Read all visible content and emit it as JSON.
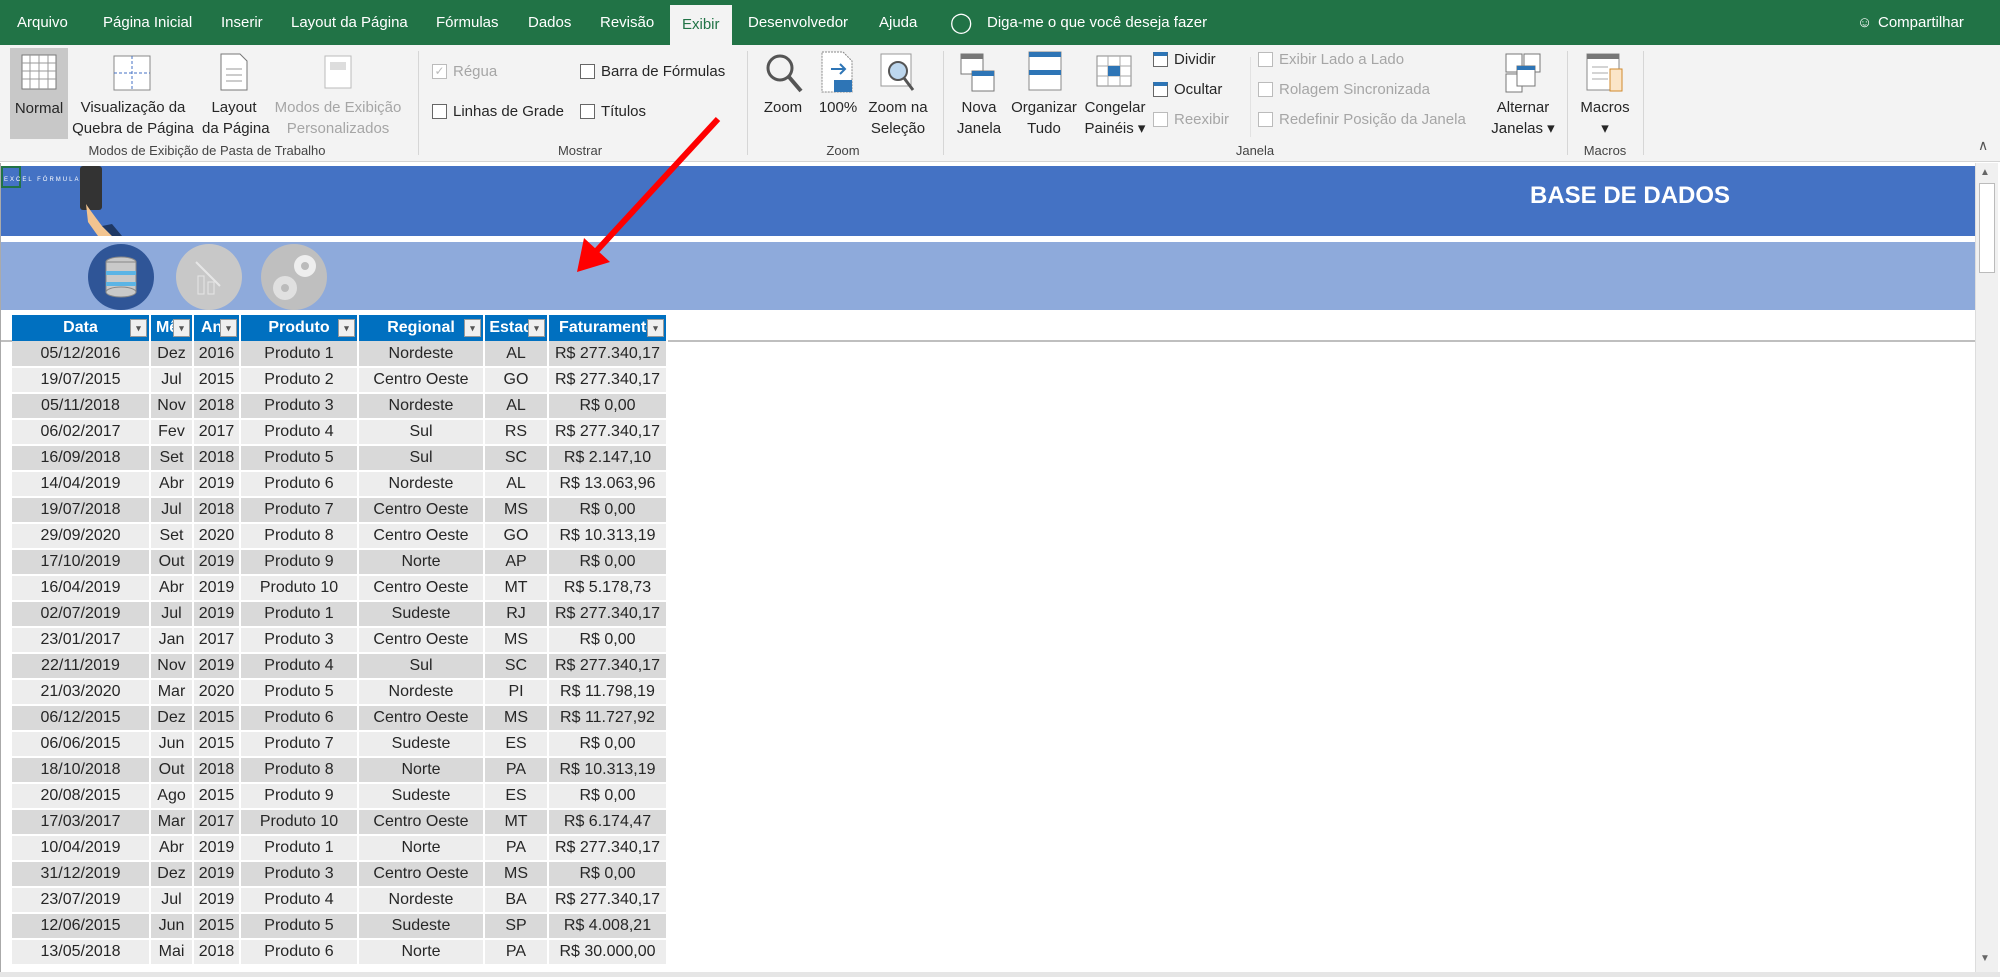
{
  "tabs": [
    "Arquivo",
    "Página Inicial",
    "Inserir",
    "Layout da Página",
    "Fórmulas",
    "Dados",
    "Revisão",
    "Exibir",
    "Desenvolvedor",
    "Ajuda"
  ],
  "active_tab": "Exibir",
  "tell_me": "Diga-me o que você deseja fazer",
  "share": "Compartilhar",
  "ribbon": {
    "views": {
      "normal": "Normal",
      "page_break_1": "Visualização da",
      "page_break_2": "Quebra de Página",
      "page_layout_1": "Layout",
      "page_layout_2": "da Página",
      "custom_1": "Modos de Exibição",
      "custom_2": "Personalizados",
      "group": "Modos de Exibição de Pasta de Trabalho"
    },
    "show": {
      "ruler": "Régua",
      "formula_bar": "Barra de Fórmulas",
      "gridlines": "Linhas de Grade",
      "headings": "Títulos",
      "group": "Mostrar",
      "ruler_checked": true,
      "formula_bar_checked": false,
      "gridlines_checked": false,
      "headings_checked": false
    },
    "zoom": {
      "zoom": "Zoom",
      "hundred": "100%",
      "sel_1": "Zoom na",
      "sel_2": "Seleção",
      "group": "Zoom"
    },
    "window": {
      "new_1": "Nova",
      "new_2": "Janela",
      "arrange_1": "Organizar",
      "arrange_2": "Tudo",
      "freeze_1": "Congelar",
      "freeze_2": "Painéis",
      "split": "Dividir",
      "hide": "Ocultar",
      "unhide": "Reexibir",
      "side": "Exibir Lado a Lado",
      "sync": "Rolagem Sincronizada",
      "reset": "Redefinir Posição da Janela",
      "switch_1": "Alternar",
      "switch_2": "Janelas",
      "group": "Janela"
    },
    "macros": {
      "label": "Macros",
      "group": "Macros"
    }
  },
  "sheet": {
    "title": "BASE DE DADOS",
    "logo_text": "EXCEL FÓRMULA",
    "nav_icons": [
      "database-icon",
      "chart-icon",
      "gears-icon"
    ],
    "colors": {
      "banner": "#4472c4",
      "band": "#8eaadb",
      "header": "#0070c0",
      "tab_green": "#217346",
      "arrow": "#ff0000"
    },
    "columns": [
      "Data",
      "Mês",
      "Ano",
      "Produto",
      "Regional",
      "Estado",
      "Faturamento"
    ],
    "rows": [
      [
        "05/12/2016",
        "Dez",
        "2016",
        "Produto 1",
        "Nordeste",
        "AL",
        "R$ 277.340,17"
      ],
      [
        "19/07/2015",
        "Jul",
        "2015",
        "Produto 2",
        "Centro Oeste",
        "GO",
        "R$ 277.340,17"
      ],
      [
        "05/11/2018",
        "Nov",
        "2018",
        "Produto 3",
        "Nordeste",
        "AL",
        "R$ 0,00"
      ],
      [
        "06/02/2017",
        "Fev",
        "2017",
        "Produto 4",
        "Sul",
        "RS",
        "R$ 277.340,17"
      ],
      [
        "16/09/2018",
        "Set",
        "2018",
        "Produto 5",
        "Sul",
        "SC",
        "R$ 2.147,10"
      ],
      [
        "14/04/2019",
        "Abr",
        "2019",
        "Produto 6",
        "Nordeste",
        "AL",
        "R$ 13.063,96"
      ],
      [
        "19/07/2018",
        "Jul",
        "2018",
        "Produto 7",
        "Centro Oeste",
        "MS",
        "R$ 0,00"
      ],
      [
        "29/09/2020",
        "Set",
        "2020",
        "Produto 8",
        "Centro Oeste",
        "GO",
        "R$ 10.313,19"
      ],
      [
        "17/10/2019",
        "Out",
        "2019",
        "Produto 9",
        "Norte",
        "AP",
        "R$ 0,00"
      ],
      [
        "16/04/2019",
        "Abr",
        "2019",
        "Produto 10",
        "Centro Oeste",
        "MT",
        "R$ 5.178,73"
      ],
      [
        "02/07/2019",
        "Jul",
        "2019",
        "Produto 1",
        "Sudeste",
        "RJ",
        "R$ 277.340,17"
      ],
      [
        "23/01/2017",
        "Jan",
        "2017",
        "Produto 3",
        "Centro Oeste",
        "MS",
        "R$ 0,00"
      ],
      [
        "22/11/2019",
        "Nov",
        "2019",
        "Produto 4",
        "Sul",
        "SC",
        "R$ 277.340,17"
      ],
      [
        "21/03/2020",
        "Mar",
        "2020",
        "Produto 5",
        "Nordeste",
        "PI",
        "R$ 11.798,19"
      ],
      [
        "06/12/2015",
        "Dez",
        "2015",
        "Produto 6",
        "Centro Oeste",
        "MS",
        "R$ 11.727,92"
      ],
      [
        "06/06/2015",
        "Jun",
        "2015",
        "Produto 7",
        "Sudeste",
        "ES",
        "R$ 0,00"
      ],
      [
        "18/10/2018",
        "Out",
        "2018",
        "Produto 8",
        "Norte",
        "PA",
        "R$ 10.313,19"
      ],
      [
        "20/08/2015",
        "Ago",
        "2015",
        "Produto 9",
        "Sudeste",
        "ES",
        "R$ 0,00"
      ],
      [
        "17/03/2017",
        "Mar",
        "2017",
        "Produto 10",
        "Centro Oeste",
        "MT",
        "R$ 6.174,47"
      ],
      [
        "10/04/2019",
        "Abr",
        "2019",
        "Produto 1",
        "Norte",
        "PA",
        "R$ 277.340,17"
      ],
      [
        "31/12/2019",
        "Dez",
        "2019",
        "Produto 3",
        "Centro Oeste",
        "MS",
        "R$ 0,00"
      ],
      [
        "23/07/2019",
        "Jul",
        "2019",
        "Produto 4",
        "Nordeste",
        "BA",
        "R$ 277.340,17"
      ],
      [
        "12/06/2015",
        "Jun",
        "2015",
        "Produto 5",
        "Sudeste",
        "SP",
        "R$ 4.008,21"
      ],
      [
        "13/05/2018",
        "Mai",
        "2018",
        "Produto 6",
        "Norte",
        "PA",
        "R$ 30.000,00"
      ]
    ]
  }
}
